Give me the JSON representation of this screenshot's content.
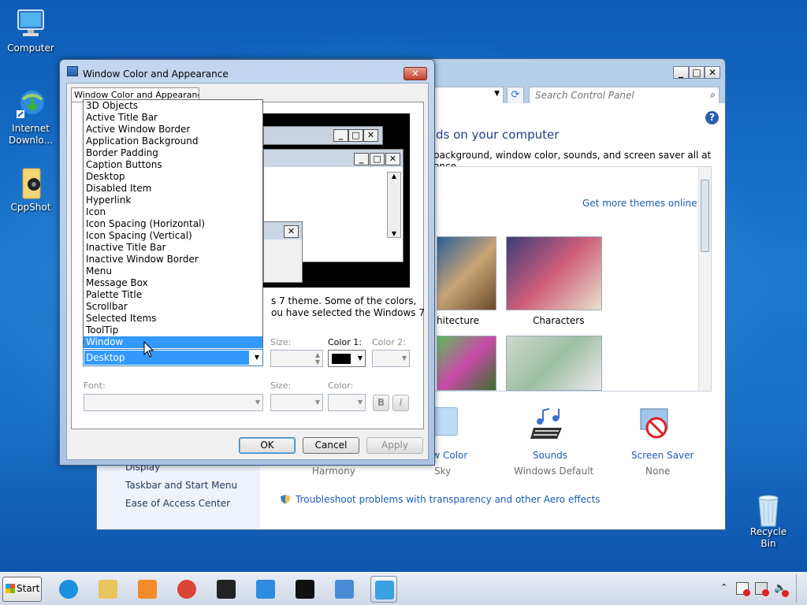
{
  "desktop": {
    "icons": [
      {
        "label": "Computer",
        "icon": "computer-icon"
      },
      {
        "label": "Internet Downlo...",
        "icon": "internet-download-manager-icon"
      },
      {
        "label": "CppShot",
        "icon": "folder-icon"
      },
      {
        "label": "Recycle Bin",
        "icon": "recycle-bin-icon"
      }
    ]
  },
  "control_panel": {
    "search_placeholder": "Search Control Panel",
    "heading": "ds on your computer",
    "subheading": "background, window color, sounds, and screen saver all at once.",
    "get_more": "Get more themes online",
    "themes": [
      {
        "label": "hitecture"
      },
      {
        "label": "Characters"
      }
    ],
    "sidebar_links": [
      "Display",
      "Taskbar and Start Menu",
      "Ease of Access Center"
    ],
    "bottom_items": [
      {
        "title": "ow Color",
        "sub": "Sky"
      },
      {
        "title": "Sounds",
        "sub": "Windows Default"
      },
      {
        "title": "Screen Saver",
        "sub": "None"
      }
    ],
    "harmony": "Harmony",
    "troubleshoot": "Troubleshoot problems with transparency and other Aero effects"
  },
  "dialog": {
    "title": "Window Color and Appearance",
    "tab": "Window Color and Appearance",
    "info_line1": "s 7 theme.  Some of the colors,",
    "info_line2": "ou have selected the Windows 7",
    "item_combo_value": "Desktop",
    "size_label": "Size:",
    "color1_label": "Color 1:",
    "color2_label": "Color 2:",
    "font_label": "Font:",
    "font_size_label": "Size:",
    "font_color_label": "Color:",
    "bold_label": "B",
    "italic_label": "I",
    "ok": "OK",
    "cancel": "Cancel",
    "apply": "Apply",
    "color1_value": "#000000",
    "list_items": [
      "3D Objects",
      "Active Title Bar",
      "Active Window Border",
      "Application Background",
      "Border Padding",
      "Caption Buttons",
      "Desktop",
      "Disabled Item",
      "Hyperlink",
      "Icon",
      "Icon Spacing (Horizontal)",
      "Icon Spacing (Vertical)",
      "Inactive Title Bar",
      "Inactive Window Border",
      "Menu",
      "Message Box",
      "Palette Title",
      "Scrollbar",
      "Selected Items",
      "ToolTip",
      "Window"
    ],
    "highlighted_item": "Window"
  },
  "taskbar": {
    "start_label": "Start",
    "apps": [
      "internet-explorer-icon",
      "windows-explorer-icon",
      "media-player-icon",
      "chrome-icon",
      "cppshot-icon",
      "internet-download-manager-icon",
      "7zip-icon",
      "control-panel-icon",
      "display-settings-icon"
    ],
    "tray_icons": [
      "show-hidden-icons-icon",
      "action-center-icon",
      "network-icon",
      "volume-icon"
    ]
  }
}
